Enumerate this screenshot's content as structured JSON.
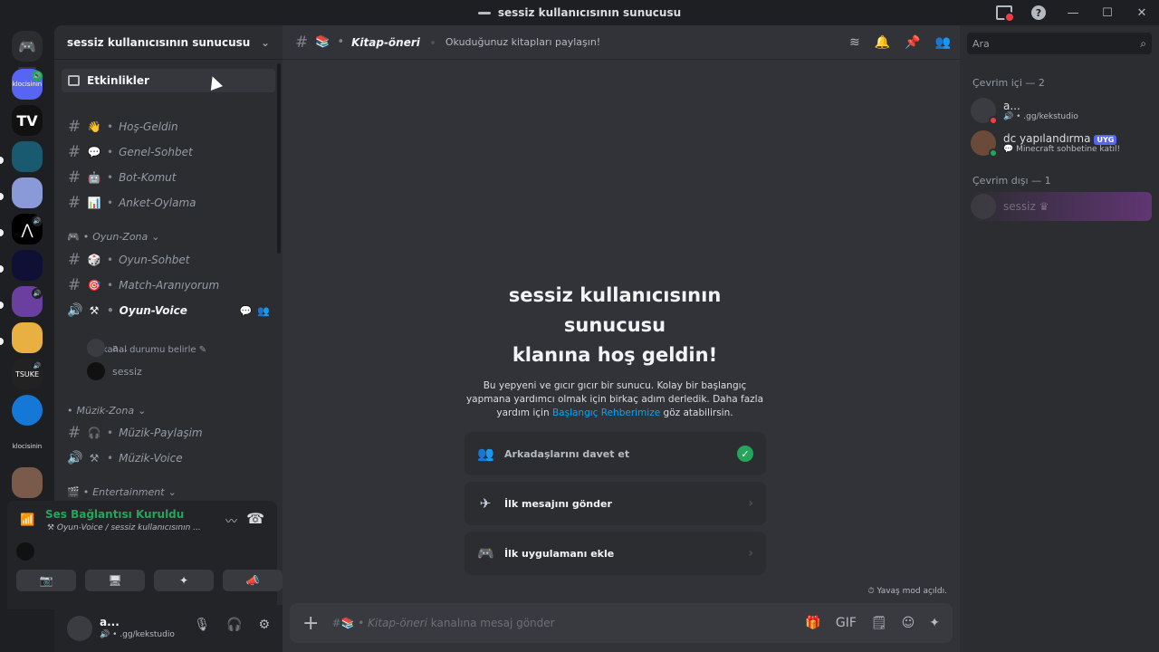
{
  "window": {
    "title": "sessiz kullanıcısının sunucusu"
  },
  "rail": {
    "servers": [
      {
        "id": "s1",
        "label": "klocisinin",
        "color": "#5865f2"
      },
      {
        "id": "s2",
        "label": "",
        "color": "#111111"
      },
      {
        "id": "s3",
        "label": "",
        "color": "#1a5a70"
      },
      {
        "id": "s4",
        "label": "",
        "color": "#8a9ad8"
      },
      {
        "id": "s5",
        "label": "",
        "color": "#000000"
      },
      {
        "id": "s6",
        "label": "",
        "color": "#101036"
      },
      {
        "id": "s7",
        "label": "",
        "color": "#6b3fa0"
      },
      {
        "id": "s8",
        "label": "",
        "color": "#e8b040"
      },
      {
        "id": "s9",
        "label": "TSUKE",
        "color": "#222222"
      },
      {
        "id": "s10",
        "label": "",
        "color": "#1577d6"
      },
      {
        "id": "s11",
        "label": "klocisinin",
        "color": "#1e1f22"
      },
      {
        "id": "s12",
        "label": "",
        "color": "#7a5a4a"
      }
    ]
  },
  "sidebar": {
    "server_name": "sessiz kullanıcısının sunucusu",
    "events_label": "Etkinlikler",
    "channels": [
      {
        "emoji": "👋",
        "name": "Hoş-Geldin"
      },
      {
        "emoji": "💬",
        "name": "Genel-Sohbet"
      },
      {
        "emoji": "🤖",
        "name": "Bot-Komut"
      },
      {
        "emoji": "📊",
        "name": "Anket-Oylama"
      }
    ],
    "cat_oyun": "Oyun-Zona",
    "oyun_channels": [
      {
        "emoji": "🎲",
        "name": "Oyun-Sohbet"
      },
      {
        "emoji": "🎯",
        "name": "Match-Aranıyorum"
      }
    ],
    "oyun_voice": "Oyun-Voice",
    "status_hint": "Bir kanal durumu belirle",
    "voice_users": [
      "a...",
      "sessiz"
    ],
    "cat_muzik": "Müzik-Zona",
    "muzik_paylasim": "Müzik-Paylaşim",
    "muzik_voice": "Müzik-Voice",
    "cat_ent": "Entertainment"
  },
  "voice_panel": {
    "status": "Ses Bağlantısı Kuruldu",
    "location": "Oyun-Voice / sessiz kullanıcısının ..."
  },
  "user": {
    "name": "a...",
    "status": ".gg/kekstudio"
  },
  "main": {
    "channel": "Kitap-öneri",
    "topic": "Okuduğunuz kitapları paylaşın!",
    "welcome_title_1": "sessiz kullanıcısının",
    "welcome_title_2": "sunucusu",
    "welcome_title_3": "klanına hoş geldin!",
    "welcome_body": "Bu yepyeni ve gıcır gıcır bir sunucu. Kolay bir başlangıç yapmana yardımcı olmak için birkaç adım derledik. Daha fazla yardım için",
    "welcome_link": "Başlangıç Rehberimize",
    "welcome_tail": "göz atabilirsin.",
    "tasks": [
      {
        "label": "Arkadaşlarını davet et",
        "done": true
      },
      {
        "label": "İlk mesajını gönder",
        "done": false
      },
      {
        "label": "İlk uygulamanı ekle",
        "done": false
      }
    ],
    "slowmode": "Yavaş mod açıldı.",
    "composer_channel": "Kitap-öneri",
    "composer_suffix": "kanalına mesaj gönder"
  },
  "members": {
    "search_placeholder": "Ara",
    "online_header": "Çevrim içi — 2",
    "online": [
      {
        "name": "a...",
        "status": ".gg/kekstudio",
        "tag": ""
      },
      {
        "name": "dc yapılandırma",
        "status": "Minecraft sohbetine katıl!",
        "tag": "UYG"
      }
    ],
    "offline_header": "Çevrim dışı — 1",
    "offline": [
      {
        "name": "sessiz"
      }
    ]
  }
}
